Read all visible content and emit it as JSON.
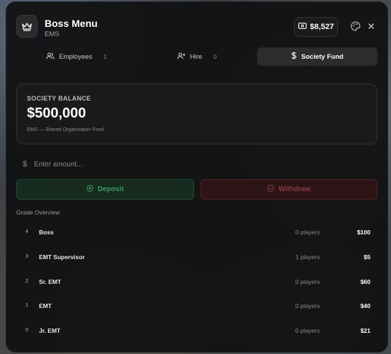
{
  "header": {
    "title": "Boss Menu",
    "subtitle": "EMS",
    "cash": "$8,527"
  },
  "icons": {
    "logo": "crown-icon",
    "cash": "cash-icon",
    "palette": "palette-icon",
    "close": "close-icon"
  },
  "tabs": [
    {
      "label": "Employees",
      "count": "1",
      "icon": "users-icon",
      "active": false
    },
    {
      "label": "Hire",
      "count": "0",
      "icon": "user-plus-icon",
      "active": false
    },
    {
      "label": "Society Fund",
      "count": "",
      "icon": "dollar-icon",
      "active": true
    }
  ],
  "balance": {
    "label": "SOCIETY BALANCE",
    "value": "$500,000",
    "note": "EMS — Shared Organization Fund"
  },
  "amount_input": {
    "prefix": "$",
    "placeholder": "Enter amount..."
  },
  "actions": {
    "deposit": "Deposit",
    "withdraw": "Withdraw"
  },
  "grades": {
    "title": "Grade Overview",
    "rows": [
      {
        "grade": "4",
        "name": "Boss",
        "players": "0 players",
        "pay": "$100"
      },
      {
        "grade": "3",
        "name": "EMT Supervisor",
        "players": "1 players",
        "pay": "$5"
      },
      {
        "grade": "2",
        "name": "Sr. EMT",
        "players": "0 players",
        "pay": "$60"
      },
      {
        "grade": "1",
        "name": "EMT",
        "players": "0 players",
        "pay": "$40"
      },
      {
        "grade": "0",
        "name": "Jr. EMT",
        "players": "0 players",
        "pay": "$21"
      }
    ]
  },
  "colors": {
    "panel": "#101011",
    "deposit_text": "#3d9a5e",
    "withdraw_text": "#8a3a3e",
    "active_tab": "#2c2c2e"
  }
}
